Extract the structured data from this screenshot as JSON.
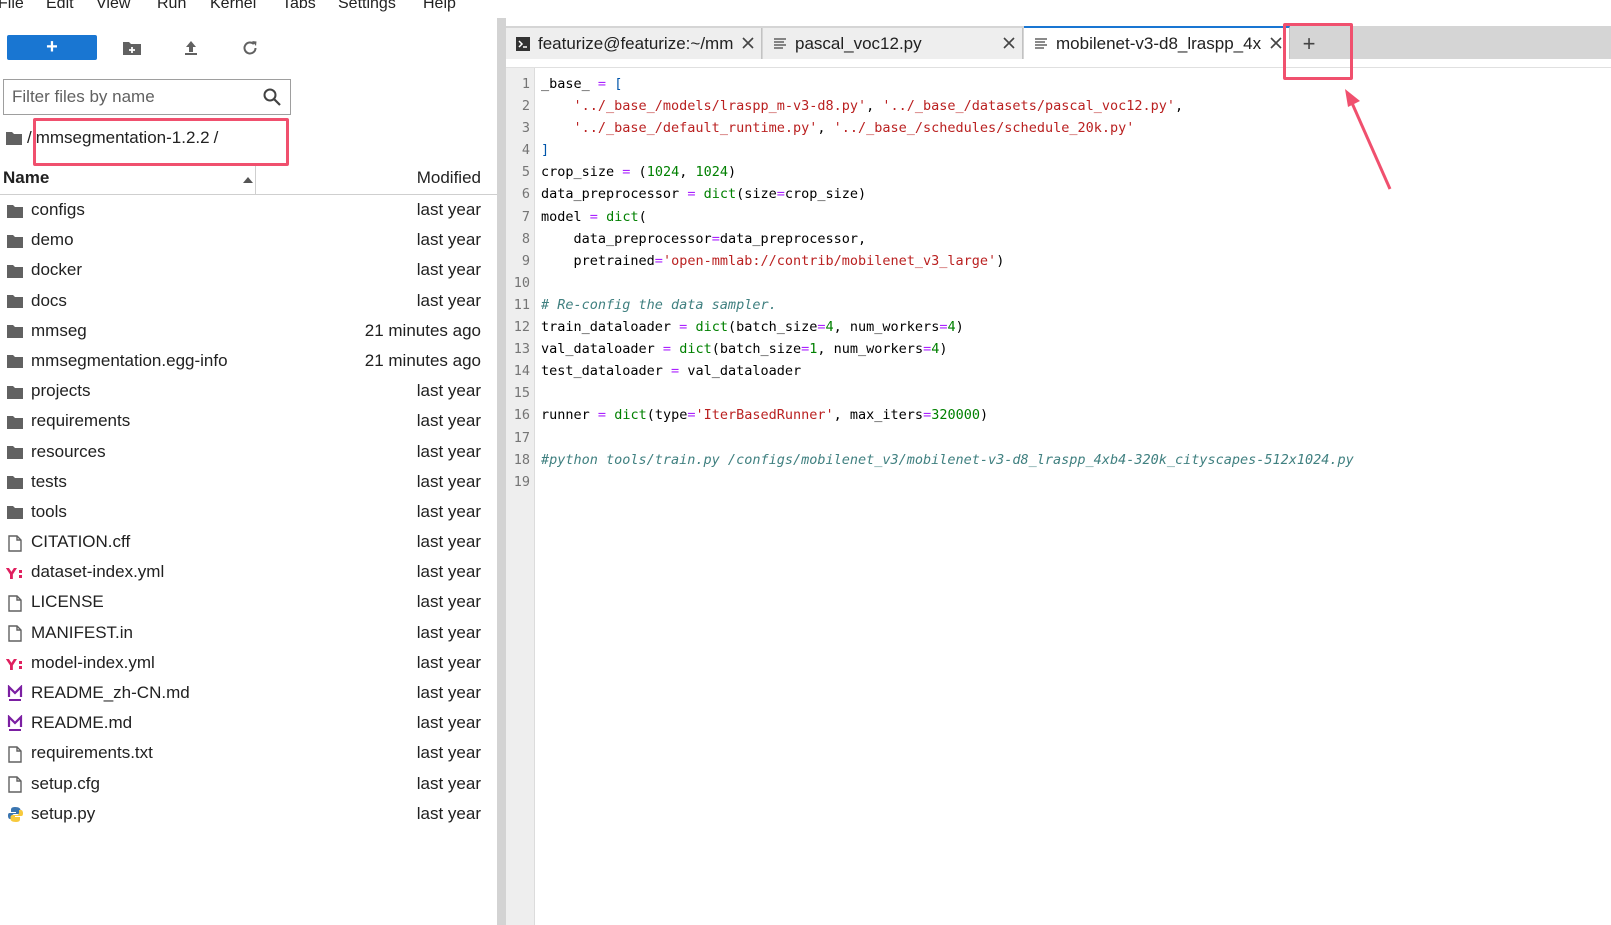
{
  "menubar": {
    "items": [
      "File",
      "Edit",
      "View",
      "Run",
      "Kernel",
      "Tabs",
      "Settings",
      "Help"
    ]
  },
  "toolbar": {
    "new_label": "+"
  },
  "filter": {
    "placeholder": "Filter files by name"
  },
  "breadcrumb": {
    "root": "/",
    "folder": "mmsegmentation-1.2.2",
    "trailing": "/"
  },
  "file_browser": {
    "columns": {
      "name": "Name",
      "modified": "Modified"
    },
    "files": [
      {
        "name": "configs",
        "modified": "last year",
        "icon": "folder-icon"
      },
      {
        "name": "demo",
        "modified": "last year",
        "icon": "folder-icon"
      },
      {
        "name": "docker",
        "modified": "last year",
        "icon": "folder-icon"
      },
      {
        "name": "docs",
        "modified": "last year",
        "icon": "folder-icon"
      },
      {
        "name": "mmseg",
        "modified": "21 minutes ago",
        "icon": "folder-icon"
      },
      {
        "name": "mmsegmentation.egg-info",
        "modified": "21 minutes ago",
        "icon": "folder-icon"
      },
      {
        "name": "projects",
        "modified": "last year",
        "icon": "folder-icon"
      },
      {
        "name": "requirements",
        "modified": "last year",
        "icon": "folder-icon"
      },
      {
        "name": "resources",
        "modified": "last year",
        "icon": "folder-icon"
      },
      {
        "name": "tests",
        "modified": "last year",
        "icon": "folder-icon"
      },
      {
        "name": "tools",
        "modified": "last year",
        "icon": "folder-icon"
      },
      {
        "name": "CITATION.cff",
        "modified": "last year",
        "icon": "file-icon"
      },
      {
        "name": "dataset-index.yml",
        "modified": "last year",
        "icon": "yaml-icon"
      },
      {
        "name": "LICENSE",
        "modified": "last year",
        "icon": "file-icon"
      },
      {
        "name": "MANIFEST.in",
        "modified": "last year",
        "icon": "file-icon"
      },
      {
        "name": "model-index.yml",
        "modified": "last year",
        "icon": "yaml-icon"
      },
      {
        "name": "README_zh-CN.md",
        "modified": "last year",
        "icon": "markdown-icon"
      },
      {
        "name": "README.md",
        "modified": "last year",
        "icon": "markdown-icon"
      },
      {
        "name": "requirements.txt",
        "modified": "last year",
        "icon": "file-icon"
      },
      {
        "name": "setup.cfg",
        "modified": "last year",
        "icon": "file-icon"
      },
      {
        "name": "setup.py",
        "modified": "last year",
        "icon": "python-icon"
      }
    ]
  },
  "tabs": [
    {
      "label": "featurize@featurize:~/mm",
      "icon": "terminal-icon",
      "active": false
    },
    {
      "label": "pascal_voc12.py",
      "icon": "text-file-icon",
      "active": false
    },
    {
      "label": "mobilenet-v3-d8_lraspp_4x",
      "icon": "text-file-icon",
      "active": true
    }
  ],
  "tab_add_label": "+",
  "editor": {
    "lines": [
      {
        "n": "1",
        "code": "_base_ = ["
      },
      {
        "n": "2",
        "code": "    '../_base_/models/lraspp_m-v3-d8.py', '../_base_/datasets/pascal_voc12.py',"
      },
      {
        "n": "3",
        "code": "    '../_base_/default_runtime.py', '../_base_/schedules/schedule_20k.py'"
      },
      {
        "n": "4",
        "code": "]"
      },
      {
        "n": "5",
        "code": "crop_size = (1024, 1024)"
      },
      {
        "n": "6",
        "code": "data_preprocessor = dict(size=crop_size)"
      },
      {
        "n": "7",
        "code": "model = dict("
      },
      {
        "n": "8",
        "code": "    data_preprocessor=data_preprocessor,"
      },
      {
        "n": "9",
        "code": "    pretrained='open-mmlab://contrib/mobilenet_v3_large')"
      },
      {
        "n": "10",
        "code": ""
      },
      {
        "n": "11",
        "code": "# Re-config the data sampler."
      },
      {
        "n": "12",
        "code": "train_dataloader = dict(batch_size=4, num_workers=4)"
      },
      {
        "n": "13",
        "code": "val_dataloader = dict(batch_size=1, num_workers=4)"
      },
      {
        "n": "14",
        "code": "test_dataloader = val_dataloader"
      },
      {
        "n": "15",
        "code": ""
      },
      {
        "n": "16",
        "code": "runner = dict(type='IterBasedRunner', max_iters=320000)"
      },
      {
        "n": "17",
        "code": ""
      },
      {
        "n": "18",
        "code": "#python tools/train.py /configs/mobilenet_v3/mobilenet-v3-d8_lraspp_4xb4-320k_cityscapes-512x1024.py"
      },
      {
        "n": "19",
        "code": ""
      }
    ]
  },
  "colors": {
    "accent": "#1976d2",
    "annotation": "#f0506e",
    "string": "#ba2121",
    "operator": "#aa22ff",
    "builtin": "#008000",
    "comment": "#408080"
  }
}
